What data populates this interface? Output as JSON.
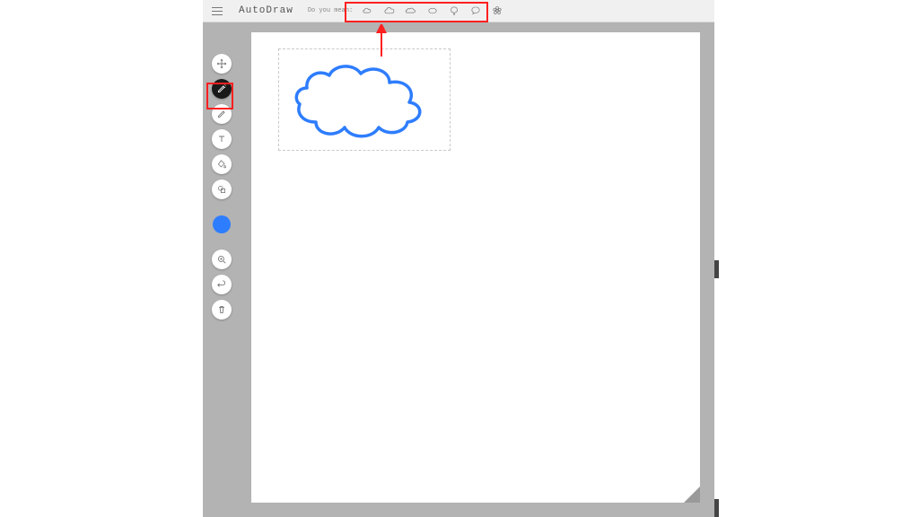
{
  "header": {
    "app_name": "AutoDraw",
    "prompt": "Do you mean:"
  },
  "suggestions": [
    {
      "name": "cloud-small"
    },
    {
      "name": "cloud"
    },
    {
      "name": "cloud-wide"
    },
    {
      "name": "ellipse"
    },
    {
      "name": "tree"
    },
    {
      "name": "speech-bubble"
    },
    {
      "name": "flower"
    }
  ],
  "tools": {
    "move": "Move",
    "autodraw": "AutoDraw",
    "draw": "Draw",
    "text": "Text",
    "fill": "Fill",
    "shape": "Shape",
    "color": "#2e7dff",
    "zoom": "Zoom",
    "undo": "Undo",
    "delete": "Delete"
  },
  "annotations": {
    "highlight_suggestions": true,
    "highlight_tool": "autodraw",
    "arrow": true
  },
  "canvas": {
    "drawing": "cloud",
    "stroke": "#2e7dff"
  }
}
